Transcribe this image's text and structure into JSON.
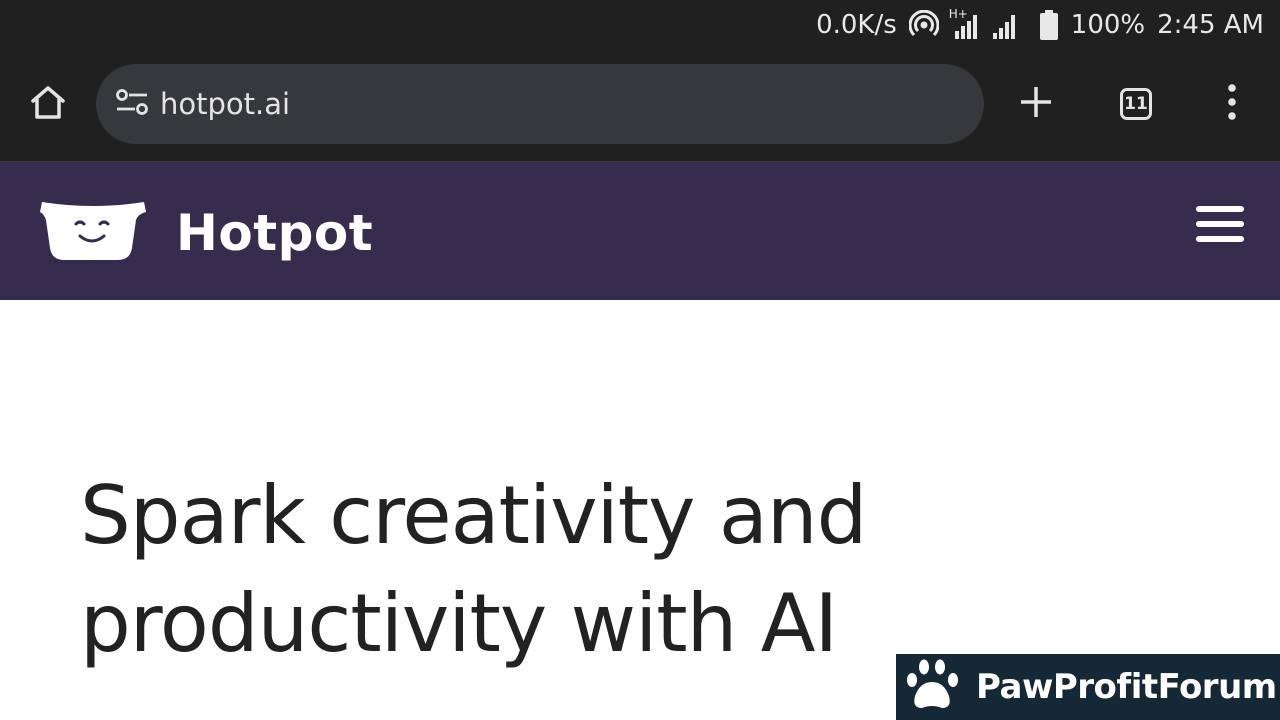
{
  "status_bar": {
    "net_speed": "0.0K/s",
    "network_type": "H+",
    "battery": "100%",
    "time": "2:45 AM",
    "icons": [
      "hotspot-icon",
      "signal-icon",
      "battery-icon"
    ]
  },
  "browser": {
    "url": "hotpot.ai",
    "tab_count": "11",
    "icons": [
      "home-icon",
      "site-settings-icon",
      "plus-icon",
      "more-vert-icon"
    ]
  },
  "site": {
    "brand": "Hotpot",
    "header_color": "#362c4e",
    "icons": [
      "hotpot-logo-icon",
      "hamburger-menu-icon"
    ]
  },
  "hero": {
    "title_line1": "Spark creativity and",
    "title_line2": "productivity with AI"
  },
  "watermark": {
    "text": "PawProfitForum",
    "icon": "paw-icon"
  }
}
